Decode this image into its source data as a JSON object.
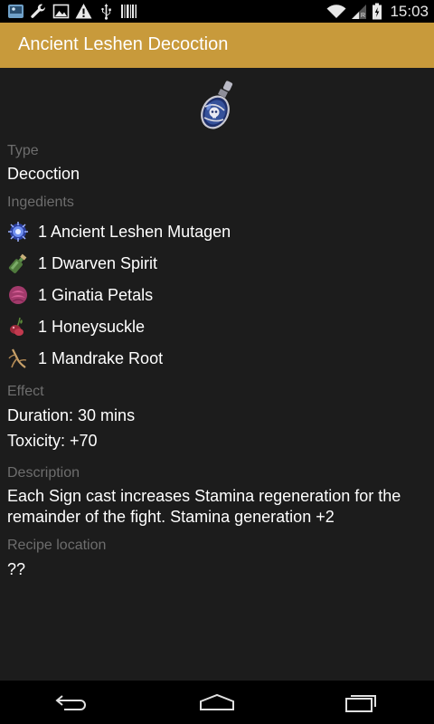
{
  "status_bar": {
    "time": "15:03",
    "left_icons": [
      "gallery-icon",
      "wrench-icon",
      "image-icon",
      "warning-icon",
      "usb-icon",
      "barcode-icon"
    ],
    "right_icons": [
      "wifi-icon",
      "signal-icon",
      "battery-icon"
    ]
  },
  "action_bar": {
    "title": "Ancient Leshen Decoction",
    "color": "#c89a3b"
  },
  "recipe": {
    "icon": "decoction-potion-icon",
    "type_label": "Type",
    "type_value": "Decoction",
    "ingredients_label": "Ingedients",
    "ingredients": [
      {
        "icon": "mutagen-icon",
        "text": "1 Ancient Leshen Mutagen"
      },
      {
        "icon": "spirit-bottle-icon",
        "text": "1 Dwarven Spirit"
      },
      {
        "icon": "petals-icon",
        "text": "1 Ginatia Petals"
      },
      {
        "icon": "honeysuckle-icon",
        "text": "1 Honeysuckle"
      },
      {
        "icon": "mandrake-root-icon",
        "text": "1 Mandrake Root"
      }
    ],
    "effect_label": "Effect",
    "duration": "Duration: 30 mins",
    "toxicity": "Toxicity: +70",
    "description_label": "Description",
    "description": "Each Sign cast increases Stamina regeneration for the remainder of the fight. Stamina generation +2",
    "location_label": "Recipe location",
    "location_value": "??"
  },
  "nav_bar": {
    "buttons": [
      "back-icon",
      "home-icon",
      "recents-icon"
    ]
  }
}
